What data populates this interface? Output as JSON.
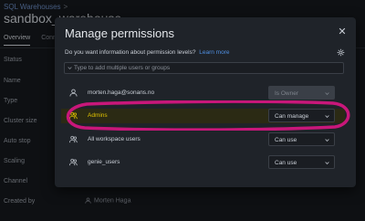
{
  "background": {
    "breadcrumb": "SQL Warehouses",
    "breadcrumb_sep": ">",
    "title": "sandbox_warehouse",
    "tabs": [
      "Overview",
      "Connection details"
    ],
    "properties": [
      "Status",
      "Name",
      "Type",
      "Cluster size",
      "Auto stop",
      "Scaling",
      "Channel",
      "Created by"
    ],
    "created_by": "Morten Haga"
  },
  "modal": {
    "title": "Manage permissions",
    "close_glyph": "✕",
    "info_text": "Do you want information about permission levels?",
    "learn_more": "Learn more",
    "search_placeholder": "Type to add multiple users or groups",
    "rows": [
      {
        "icon": "user-icon",
        "name": "morten.haga@sonans.no",
        "permission": "Is Owner",
        "disabled": true
      },
      {
        "icon": "group-icon",
        "name": "Admins",
        "permission": "Can manage",
        "disabled": false,
        "highlighted": true
      },
      {
        "icon": "group-icon",
        "name": "All workspace users",
        "permission": "Can use",
        "disabled": false
      },
      {
        "icon": "group-icon",
        "name": "genie_users",
        "permission": "Can use",
        "disabled": false
      }
    ]
  },
  "colors": {
    "highlight": "#c8177a",
    "link": "#4f8fe0",
    "admins_row": "#2b2a14"
  }
}
